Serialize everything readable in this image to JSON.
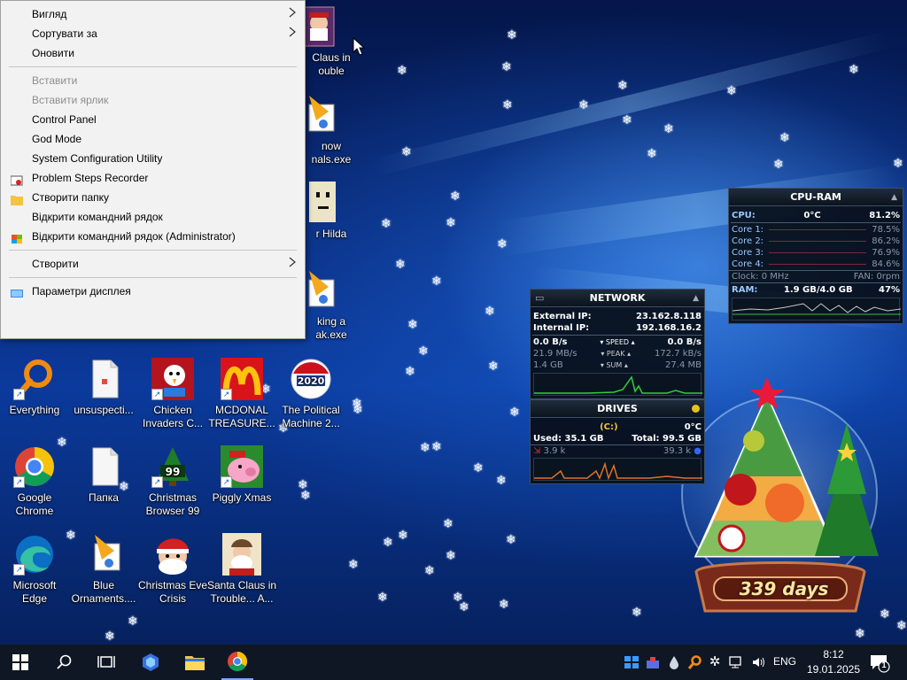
{
  "context_menu": {
    "items": [
      {
        "label": "Вигляд",
        "submenu": true
      },
      {
        "label": "Сортувати за",
        "submenu": true
      },
      {
        "label": "Оновити"
      },
      {
        "sep": true
      },
      {
        "label": "Вставити",
        "disabled": true
      },
      {
        "label": "Вставити ярлик",
        "disabled": true
      },
      {
        "label": "Control Panel"
      },
      {
        "label": "God Mode"
      },
      {
        "label": "System Configuration Utility"
      },
      {
        "label": "Problem Steps Recorder",
        "icon": "recorder-icon"
      },
      {
        "label": "Створити папку",
        "icon": "folder-icon"
      },
      {
        "label": "Відкрити командний рядок"
      },
      {
        "label": "Відкрити командний рядок (Administrator)",
        "icon": "shield-icon"
      },
      {
        "sep": true
      },
      {
        "label": "Створити",
        "submenu": true
      },
      {
        "sep": true
      },
      {
        "label": "Параметри дисплея",
        "icon": "display-icon"
      }
    ]
  },
  "desktop_icons": {
    "santa_top": "Claus in\nouble",
    "snow": "now\nnals.exe",
    "hilda": "r Hilda",
    "king": "king a\nak.exe",
    "everything": "Everything",
    "unsuspecting": "unsuspecti...",
    "chicken": "Chicken\nInvaders C...",
    "mcdonald": "MCDONAL\nTREASURE...",
    "political": "The Political\nMachine 2...",
    "chrome": "Google\nChrome",
    "folder": "Папка",
    "browser99": "Christmas\nBrowser 99",
    "piggly": "Piggly Xmas",
    "edge": "Microsoft\nEdge",
    "blue": "Blue\nOrnaments....",
    "christmas_eve": "Christmas Eve\nCrisis",
    "santa": "Santa Claus in\nTrouble... A...",
    "political_badge": "2020"
  },
  "cpu_ram": {
    "title": "CPU-RAM",
    "cpu_label": "CPU:",
    "cpu_temp": "0°C",
    "cpu_pct": "81.2%",
    "cores": [
      {
        "label": "Core 1:",
        "value": "78.5%"
      },
      {
        "label": "Core 2:",
        "value": "86.2%"
      },
      {
        "label": "Core 3:",
        "value": "76.9%"
      },
      {
        "label": "Core 4:",
        "value": "84.6%"
      }
    ],
    "clock": "Clock: 0 MHz",
    "fan": "FAN: 0rpm",
    "ram_label": "RAM:",
    "ram_used": "1.9 GB/4.0 GB",
    "ram_pct": "47%"
  },
  "network": {
    "title": "NETWORK",
    "ext_label": "External IP:",
    "ext_ip": "23.162.8.118",
    "int_label": "Internal IP:",
    "int_ip": "192.168.16.2",
    "speed_down": "0.0 B/s",
    "speed_label": "SPEED",
    "speed_up": "0.0 B/s",
    "peak_down": "21.9 MB/s",
    "peak_label": "PEAK",
    "peak_up": "172.7 kB/s",
    "sum_down": "1.4 GB",
    "sum_label": "SUM",
    "sum_up": "27.4 MB"
  },
  "drives": {
    "title": "DRIVES",
    "drive": "(C:)",
    "temp": "0°C",
    "used": "Used: 35.1 GB",
    "total": "Total: 99.5 GB",
    "read": "3.9 k",
    "write": "39.3 k"
  },
  "countdown": {
    "text": "339 days"
  },
  "taskbar": {
    "language": "ENG",
    "time": "8:12",
    "date": "19.01.2025",
    "notifications": "1"
  }
}
